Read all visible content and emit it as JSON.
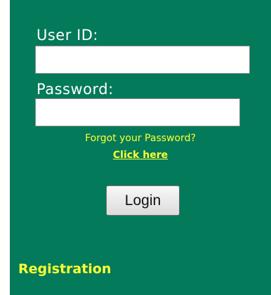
{
  "login_form": {
    "user_id_label": "User ID:",
    "user_id_value": "",
    "password_label": "Password:",
    "password_value": "",
    "forgot_text": "Forgot your Password?",
    "forgot_link": "Click here",
    "login_button": "Login"
  },
  "registration_link": "Registration",
  "colors": {
    "panel_background": "#037a5a",
    "label_text": "#ffffff",
    "link_text": "#ffff33"
  }
}
